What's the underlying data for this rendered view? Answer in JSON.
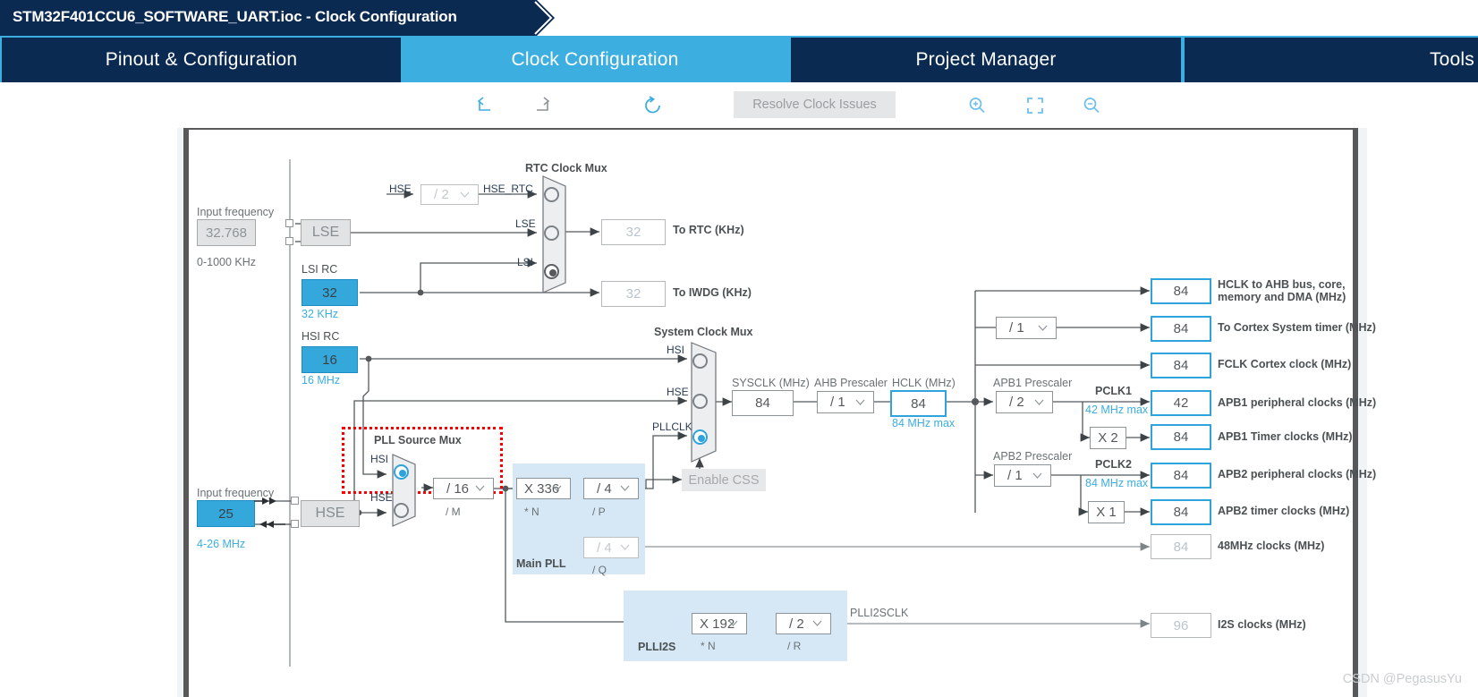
{
  "window": {
    "title": "STM32F401CCU6_SOFTWARE_UART.ioc - Clock Configuration"
  },
  "tabs": [
    {
      "label": "Pinout & Configuration",
      "active": false
    },
    {
      "label": "Clock Configuration",
      "active": true
    },
    {
      "label": "Project Manager",
      "active": false
    },
    {
      "label": "Tools",
      "active": false
    }
  ],
  "toolbar": {
    "undo_icon": "undo-arrow-icon",
    "redo_icon": "redo-arrow-icon",
    "reset_icon": "refresh-circle-icon",
    "resolve_label": "Resolve Clock Issues",
    "zoom_in_icon": "zoom-in-magnifier-icon",
    "fit_icon": "fit-to-screen-icon",
    "zoom_out_icon": "zoom-out-magnifier-icon"
  },
  "clock_tree": {
    "lse": {
      "input_frequency_label": "Input frequency",
      "input_frequency_value": "32.768",
      "range": "0-1000 KHz",
      "box_label": "LSE"
    },
    "lsi": {
      "title": "LSI RC",
      "value": "32",
      "unit": "32 KHz"
    },
    "hsi": {
      "title": "HSI RC",
      "value": "16",
      "unit": "16 MHz"
    },
    "hse": {
      "input_frequency_label": "Input frequency",
      "input_frequency_value": "25",
      "range": "4-26 MHz",
      "box_label": "HSE"
    },
    "rtc_hse_divider": {
      "in_label": "HSE",
      "value": "/ 2",
      "out_label": "HSE_RTC"
    },
    "rtc_clock_mux": {
      "title": "RTC Clock Mux",
      "inputs": [
        "HSE_RTC",
        "LSE",
        "LSI"
      ],
      "selected": "LSI"
    },
    "to_rtc": {
      "value": "32",
      "label": "To RTC (KHz)"
    },
    "to_iwdg": {
      "value": "32",
      "label": "To IWDG (KHz)"
    },
    "pll_source_mux": {
      "title": "PLL Source Mux",
      "inputs": [
        "HSI",
        "HSE"
      ],
      "selected": "HSI",
      "highlighted": true
    },
    "pll_m": {
      "value": "/ 16",
      "name": "/ M"
    },
    "main_pll": {
      "group_label": "Main PLL",
      "n": {
        "value": "X 336",
        "name": "* N"
      },
      "p": {
        "value": "/ 4",
        "name": "/ P"
      },
      "q": {
        "value": "/ 4",
        "name": "/ Q"
      }
    },
    "system_clock_mux": {
      "title": "System Clock Mux",
      "inputs": [
        "HSI",
        "HSE",
        "PLLCLK"
      ],
      "selected": "PLLCLK"
    },
    "enable_css": {
      "label": "Enable CSS"
    },
    "sysclk": {
      "title": "SYSCLK (MHz)",
      "value": "84"
    },
    "ahb_prescaler": {
      "title": "AHB Prescaler",
      "value": "/ 1"
    },
    "hclk": {
      "title": "HCLK (MHz)",
      "value": "84",
      "max": "84 MHz max"
    },
    "cortex_prescaler": {
      "value": "/ 1"
    },
    "apb1_prescaler": {
      "title": "APB1 Prescaler",
      "value": "/ 2"
    },
    "apb2_prescaler": {
      "title": "APB2 Prescaler",
      "value": "/ 1"
    },
    "pclk1": {
      "label": "PCLK1",
      "max": "42 MHz max"
    },
    "pclk2": {
      "label": "PCLK2",
      "max": "84 MHz max"
    },
    "apb1_timer_mult": {
      "value": "X 2"
    },
    "apb2_timer_mult": {
      "value": "X 1"
    },
    "plli2s": {
      "group_label": "PLLI2S",
      "n": {
        "value": "X 192",
        "name": "* N"
      },
      "r": {
        "value": "/ 2",
        "name": "/ R"
      },
      "out_label": "PLLI2SCLK"
    },
    "outputs": [
      {
        "value": "84",
        "label": "HCLK to AHB bus, core,",
        "label2": "memory and DMA (MHz)",
        "style": "blueborder"
      },
      {
        "value": "84",
        "label": "To Cortex System timer (MHz)",
        "style": "blueborder"
      },
      {
        "value": "84",
        "label": "FCLK Cortex clock (MHz)",
        "style": "blueborder"
      },
      {
        "value": "42",
        "label": "APB1 peripheral clocks (MHz)",
        "style": "blueborder"
      },
      {
        "value": "84",
        "label": "APB1 Timer clocks (MHz)",
        "style": "blueborder"
      },
      {
        "value": "84",
        "label": "APB2 peripheral clocks (MHz)",
        "style": "blueborder"
      },
      {
        "value": "84",
        "label": "APB2 timer clocks (MHz)",
        "style": "blueborder"
      },
      {
        "value": "84",
        "label": "48MHz clocks (MHz)",
        "style": "dim"
      },
      {
        "value": "96",
        "label": "I2S clocks (MHz)",
        "style": "dim"
      }
    ]
  },
  "watermark": {
    "text": "CSDN @PegasusYu"
  },
  "colors": {
    "header_navy": "#0a2A52",
    "accent_blue": "#3CAEE0",
    "fill_blue": "#34A8DB",
    "highlight_red": "#fb0000",
    "pll_group_bg": "#d6e8f5"
  }
}
